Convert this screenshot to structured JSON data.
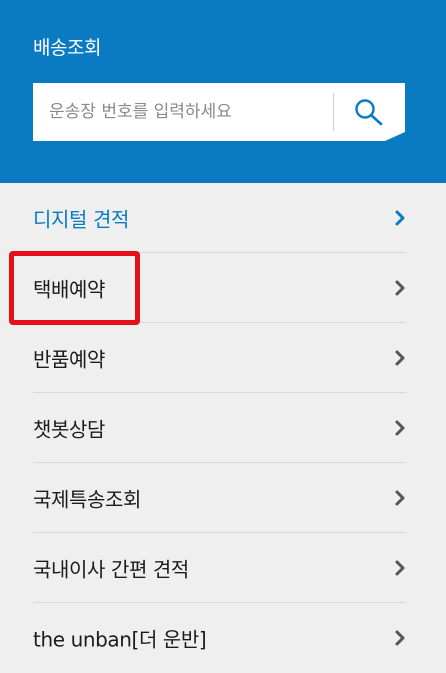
{
  "header": {
    "title": "배송조회",
    "search": {
      "placeholder": "운송장 번호를 입력하세요",
      "value": "",
      "button_icon": "search-icon"
    }
  },
  "menu": {
    "items": [
      {
        "label": "디지털 견적",
        "active": true,
        "icon": "chevron-right-icon"
      },
      {
        "label": "택배예약",
        "active": false,
        "highlighted": true,
        "icon": "chevron-right-icon"
      },
      {
        "label": "반품예약",
        "active": false,
        "icon": "chevron-right-icon"
      },
      {
        "label": "챗봇상담",
        "active": false,
        "icon": "chevron-right-icon"
      },
      {
        "label": "국제특송조회",
        "active": false,
        "icon": "chevron-right-icon"
      },
      {
        "label": "국내이사 간편 견적",
        "active": false,
        "icon": "chevron-right-icon"
      },
      {
        "label": "the unban[더 운반]",
        "active": false,
        "icon": "chevron-right-icon"
      }
    ]
  },
  "colors": {
    "brand_blue": "#0a7ac3",
    "background": "#efefef",
    "highlight_red": "#e5101a",
    "text": "#1c1c1c"
  }
}
